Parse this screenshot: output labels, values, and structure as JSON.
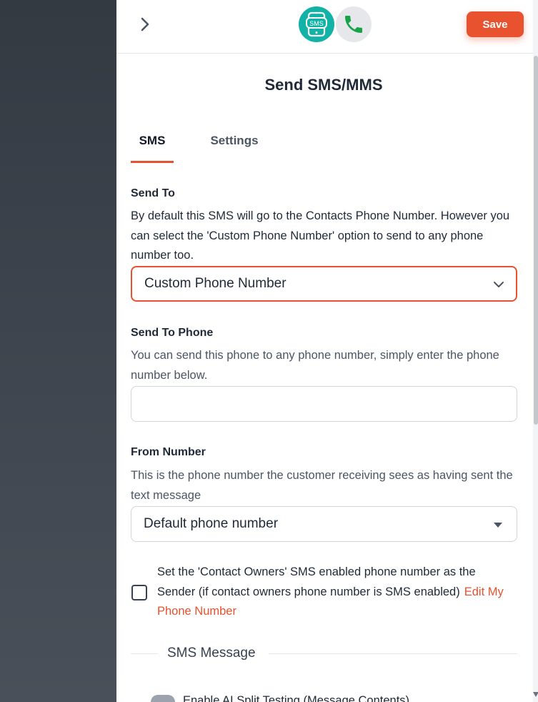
{
  "header": {
    "save_label": "Save",
    "sms_icon_text": "SMS"
  },
  "panel": {
    "title": "Send SMS/MMS",
    "tabs": [
      {
        "label": "SMS",
        "active": true
      },
      {
        "label": "Settings",
        "active": false
      }
    ]
  },
  "send_to": {
    "label": "Send To",
    "help": "By default this SMS will go to the Contacts Phone Number. However you can select the 'Custom Phone Number' option to send to any phone number too.",
    "selected": "Custom Phone Number"
  },
  "send_to_phone": {
    "label": "Send To Phone",
    "help": "You can send this phone to any phone number, simply enter the phone number below.",
    "value": "",
    "placeholder": ""
  },
  "from_number": {
    "label": "From Number",
    "help": "This is the phone number the customer receiving sees as having sent the text message",
    "selected": "Default phone number"
  },
  "owner_sender": {
    "checked": false,
    "text": "Set the 'Contact Owners' SMS enabled phone number as the Sender (if contact owners phone number is SMS enabled)",
    "link": "Edit My Phone Number"
  },
  "sms_message": {
    "section_label": "SMS Message",
    "ai_split_label": "Enable AI Split Testing (Message Contents)"
  },
  "colors": {
    "accent": "#e8522e",
    "sms_icon_bg": "#13b2a6",
    "phone_icon": "#16a34a"
  },
  "icons": [
    "chevron-right-icon",
    "sms-phone-icon",
    "phone-call-icon",
    "chevron-down-icon",
    "caret-down-icon"
  ]
}
